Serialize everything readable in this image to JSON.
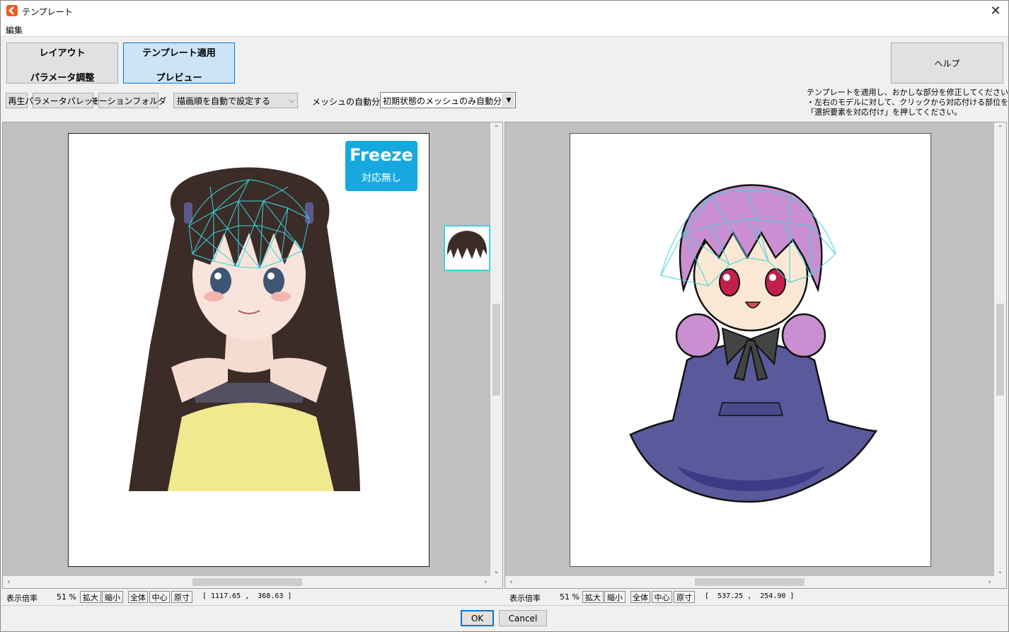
{
  "window": {
    "title": "テンプレート"
  },
  "menu": {
    "edit": "編集"
  },
  "modes": {
    "layout_line1": "レイアウト",
    "layout_line2": "パラメータ調整",
    "template_line1": "テンプレート適用",
    "template_line2": "プレビュー",
    "help": "ヘルプ"
  },
  "toolbar": {
    "play": "再生",
    "param_palette": "パラメータパレット",
    "motion_folder": "モーションフォルダ",
    "draw_order": "描画順を自動で設定する",
    "mesh_label": "メッシュの自動分割",
    "mesh_value": "初期状態のメッシュのみ自動分割"
  },
  "instructions": "テンプレートを適用し、おかしな部分を修正してください。\n・左右のモデルに対して、クリックから対応付ける部位を選び、\n「選択要素を対応付け」を押してください。",
  "freeze": {
    "title": "Freeze",
    "subtitle": "対応無し"
  },
  "left_status": {
    "zoom_label": "表示倍率",
    "zoom_value": "51 %",
    "zoom_in": "拡大",
    "zoom_out": "縮小",
    "fit": "全体",
    "center": "中心",
    "actual": "原寸",
    "coords": "[ 1117.65 ,  368.63 ]"
  },
  "right_status": {
    "zoom_label": "表示倍率",
    "zoom_value": "51 %",
    "zoom_in": "拡大",
    "zoom_out": "縮小",
    "fit": "全体",
    "center": "中心",
    "actual": "原寸",
    "coords": "[  537.25 ,  254.90 ]"
  },
  "dialog": {
    "ok": "OK",
    "cancel": "Cancel"
  },
  "colors": {
    "accent": "#0078d7",
    "selected_mode": "#cce4f7",
    "freeze_badge": "#17a8e0",
    "mesh_lines": "#3ad3e0",
    "app_icon": "#ef5b25"
  }
}
